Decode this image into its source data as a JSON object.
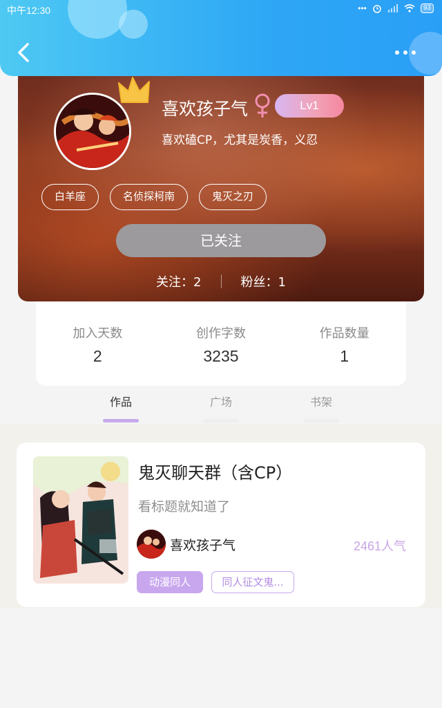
{
  "status_bar": {
    "time": "中午12:30",
    "battery": "93"
  },
  "profile": {
    "username": "喜欢孩子气",
    "level": "Lv1",
    "bio": "喜欢磕CP，尤其是炭香，义忍",
    "tags": [
      "白羊座",
      "名侦探柯南",
      "鬼灭之刃"
    ],
    "follow_button": "已关注",
    "following": "关注：2",
    "followers": "粉丝：1"
  },
  "stats": [
    {
      "label": "加入天数",
      "value": "2"
    },
    {
      "label": "创作字数",
      "value": "3235"
    },
    {
      "label": "作品数量",
      "value": "1"
    }
  ],
  "tabs": [
    {
      "label": "作品",
      "active": true
    },
    {
      "label": "广场",
      "active": false
    },
    {
      "label": "书架",
      "active": false
    }
  ],
  "work": {
    "title": "鬼灭聊天群（含CP）",
    "description": "看标题就知道了",
    "author": "喜欢孩子气",
    "popularity": "2461人气",
    "tags": [
      "动漫同人",
      "同人征文鬼..."
    ]
  },
  "colors": {
    "header": "#2ea7f5",
    "accent_purple": "#c8a7ee",
    "follow_gray": "#9c9a9c"
  }
}
